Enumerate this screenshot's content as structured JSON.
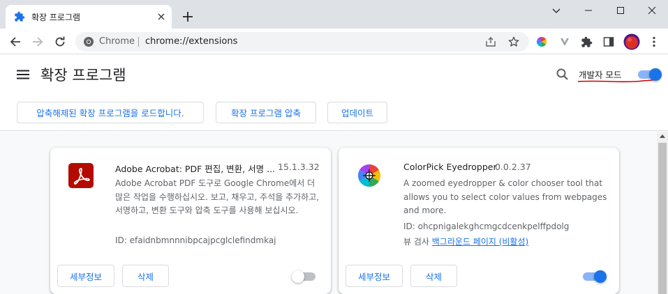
{
  "colors": {
    "accent": "#1a73e8",
    "accent_light": "#8ab4f8",
    "tabstrip_bg": "#dee1e6",
    "content_bg": "#f8f9fa",
    "annotation_red": "#d40000"
  },
  "tab": {
    "title": "확장 프로그램",
    "favicon": "puzzle-icon"
  },
  "omnibox": {
    "site_label": "Chrome",
    "url": "chrome://extensions"
  },
  "toolbar_icons": [
    "back-icon",
    "forward-icon",
    "reload-icon",
    "share-icon",
    "bookmark-star-icon",
    "colorpick-extension-icon",
    "vivaldi-extension-icon",
    "extensions-puzzle-icon",
    "side-panel-icon",
    "profile-avatar",
    "more-menu-icon"
  ],
  "header": {
    "title": "확장 프로그램",
    "dev_mode_label": "개발자 모드",
    "dev_mode_on": true
  },
  "actions": {
    "load_unpacked": "압축해제된 확장 프로그램을 로드합니다.",
    "pack_extension": "확장 프로그램 압축",
    "update": "업데이트"
  },
  "extensions": [
    {
      "name": "Adobe Acrobat: PDF 편집, 변환, 서명 ...",
      "version": "15.1.3.32",
      "description": "Adobe Acrobat PDF 도구로 Google Chrome에서 더 많은 작업을 수행하십시오. 보고, 채우고, 주석을 추가하고, 서명하고, 변환 도구와 압축 도구를 사용해 보십시오.",
      "id_text": "ID: efaidnbmnnnibpcajpcglclefindmkaj",
      "details_label": "세부정보",
      "remove_label": "삭제",
      "enabled": false
    },
    {
      "name": "ColorPick Eyedropper",
      "version": "0.0.2.37",
      "description": "A zoomed eyedropper & color chooser tool that allows you to select color values from webpages and more.",
      "id_text": "ID: ohcpnigalekghcmgcdcenkpelffpdolg",
      "inspect_prefix": "뷰 검사",
      "inspect_link": "백그라운드 페이지 (비활성)",
      "details_label": "세부정보",
      "remove_label": "삭제",
      "enabled": true
    }
  ]
}
